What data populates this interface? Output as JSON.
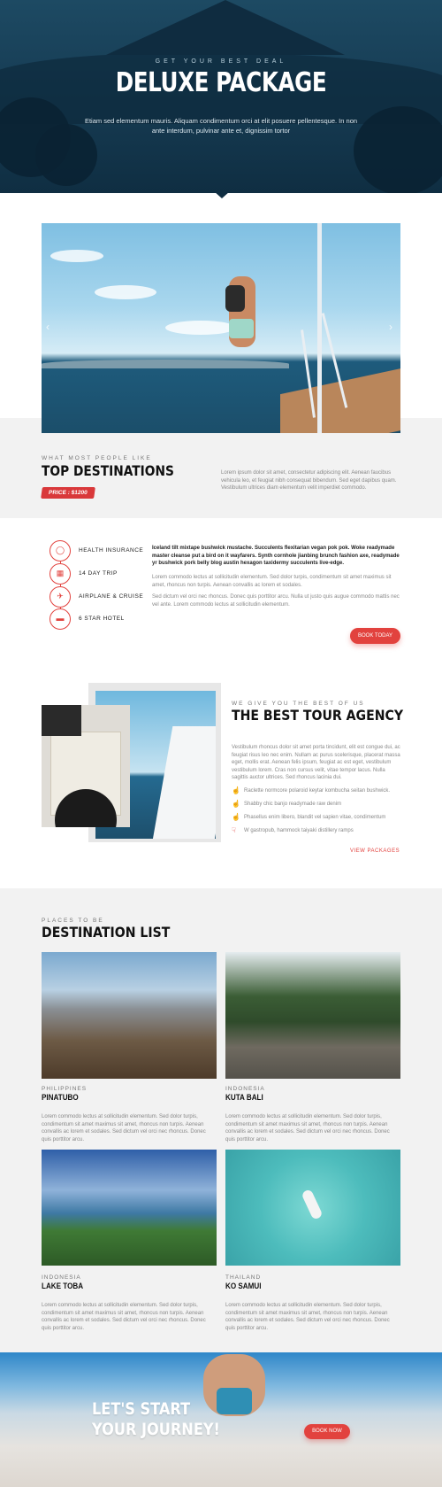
{
  "hero": {
    "kicker": "GET YOUR BEST DEAL",
    "title": "DELUXE PACKAGE",
    "text": "Etiam sed elementum mauris. Aliquam condimentum orci at elit posuere pellentesque. In non ante interdum, pulvinar ante et, dignissim tortor"
  },
  "slider": {
    "prev_arrow": "‹",
    "next_arrow": "›"
  },
  "top_destinations": {
    "kicker": "WHAT MOST PEOPLE LIKE",
    "title": "TOP DESTINATIONS",
    "price": "PRICE : $1200",
    "text": "Lorem ipsum dolor sit amet, consectetur adipiscing elit. Aenean faucibus vehicula leo, et feugiat nibh consequat bibendum. Sed eget dapibus quam. Vestibulum ultrices diam elementum velit imperdiet commodo."
  },
  "features": {
    "items": [
      {
        "label": "HEALTH INSURANCE",
        "icon": "shield-icon"
      },
      {
        "label": "14 DAY TRIP",
        "icon": "calendar-icon"
      },
      {
        "label": "AIRPLANE & CRUISE",
        "icon": "airplane-icon"
      },
      {
        "label": "6 STAR HOTEL",
        "icon": "bed-icon"
      }
    ],
    "bold_text": "Iceland tilt mixtape bushwick mustache. Succulents flexitarian vegan pok pok. Woke readymade master cleanse put a bird on it wayfarers. Synth cornhole jianbing brunch fashion axe, readymade yr bushwick pork belly blog austin hexagon taxidermy succulents live-edge.",
    "p1": "Lorem commodo lectus at sollicitudin elementum. Sed dolor turpis, condimentum sit amet maximus sit amet, rhoncus non turpis. Aenean convallis ac lorem et sodales.",
    "p2": "Sed dictum vel orci nec rhoncus. Donec quis porttitor arcu. Nulla ut justo quis augue commodo mattis nec vel ante. Lorem commodo lectus at sollicitudin elementum.",
    "button": "BOOK TODAY"
  },
  "agency": {
    "kicker": "WE GIVE YOU THE BEST OF US",
    "title": "THE BEST TOUR AGENCY",
    "text": "Vestibulum rhoncus dolor sit amet porta tincidunt, elit est congue dui, ac feugiat risus leo nec enim. Nullam ac purus scelerisque, placerat massa eget, mollis erat. Aenean felis ipsum, feugiat ac est eget, vestibulum vestibulum lorem. Cras non cursus velit, vitae tempor lacus. Nulla sagittis auctor ultrices. Sed rhoncus lacinia dui.",
    "items": [
      "Raclette normcore polaroid keytar kombucha seitan bushwick.",
      "Shabby chic banjo readymade raw denim",
      "Phasellus enim libero, blandit vel sapien vitae, condimentum",
      "W gastropub, hammock taiyaki distillery ramps"
    ],
    "link": "VIEW PACKAGES"
  },
  "destinations": {
    "kicker": "PLACES TO BE",
    "title": "DESTINATION LIST",
    "cards": [
      {
        "country": "PHILIPPINES",
        "name": "PINATUBO",
        "text": "Lorem commodo lectus at sollicitudin elementum. Sed dolor turpis, condimentum sit amet maximus sit amet, rhoncus non turpis. Aenean convallis ac lorem et sodales. Sed dictum vel orci nec rhoncus. Donec quis porttitor arcu."
      },
      {
        "country": "INDONESIA",
        "name": "KUTA BALI",
        "text": "Lorem commodo lectus at sollicitudin elementum. Sed dolor turpis, condimentum sit amet maximus sit amet, rhoncus non turpis. Aenean convallis ac lorem et sodales. Sed dictum vel orci nec rhoncus. Donec quis porttitor arcu."
      },
      {
        "country": "INDONESIA",
        "name": "LAKE TOBA",
        "text": "Lorem commodo lectus at sollicitudin elementum. Sed dolor turpis, condimentum sit amet maximus sit amet, rhoncus non turpis. Aenean convallis ac lorem et sodales. Sed dictum vel orci nec rhoncus. Donec quis porttitor arcu."
      },
      {
        "country": "THAILAND",
        "name": "KO SAMUI",
        "text": "Lorem commodo lectus at sollicitudin elementum. Sed dolor turpis, condimentum sit amet maximus sit amet, rhoncus non turpis. Aenean convallis ac lorem et sodales. Sed dictum vel orci nec rhoncus. Donec quis porttitor arcu."
      }
    ]
  },
  "cta": {
    "line1": "LET'S START",
    "line2": "YOUR JOURNEY!",
    "button": "BOOK NOW"
  },
  "colors": {
    "accent": "#e2423e",
    "hero_bg": "#173d55",
    "section_gray": "#f2f2f2"
  }
}
